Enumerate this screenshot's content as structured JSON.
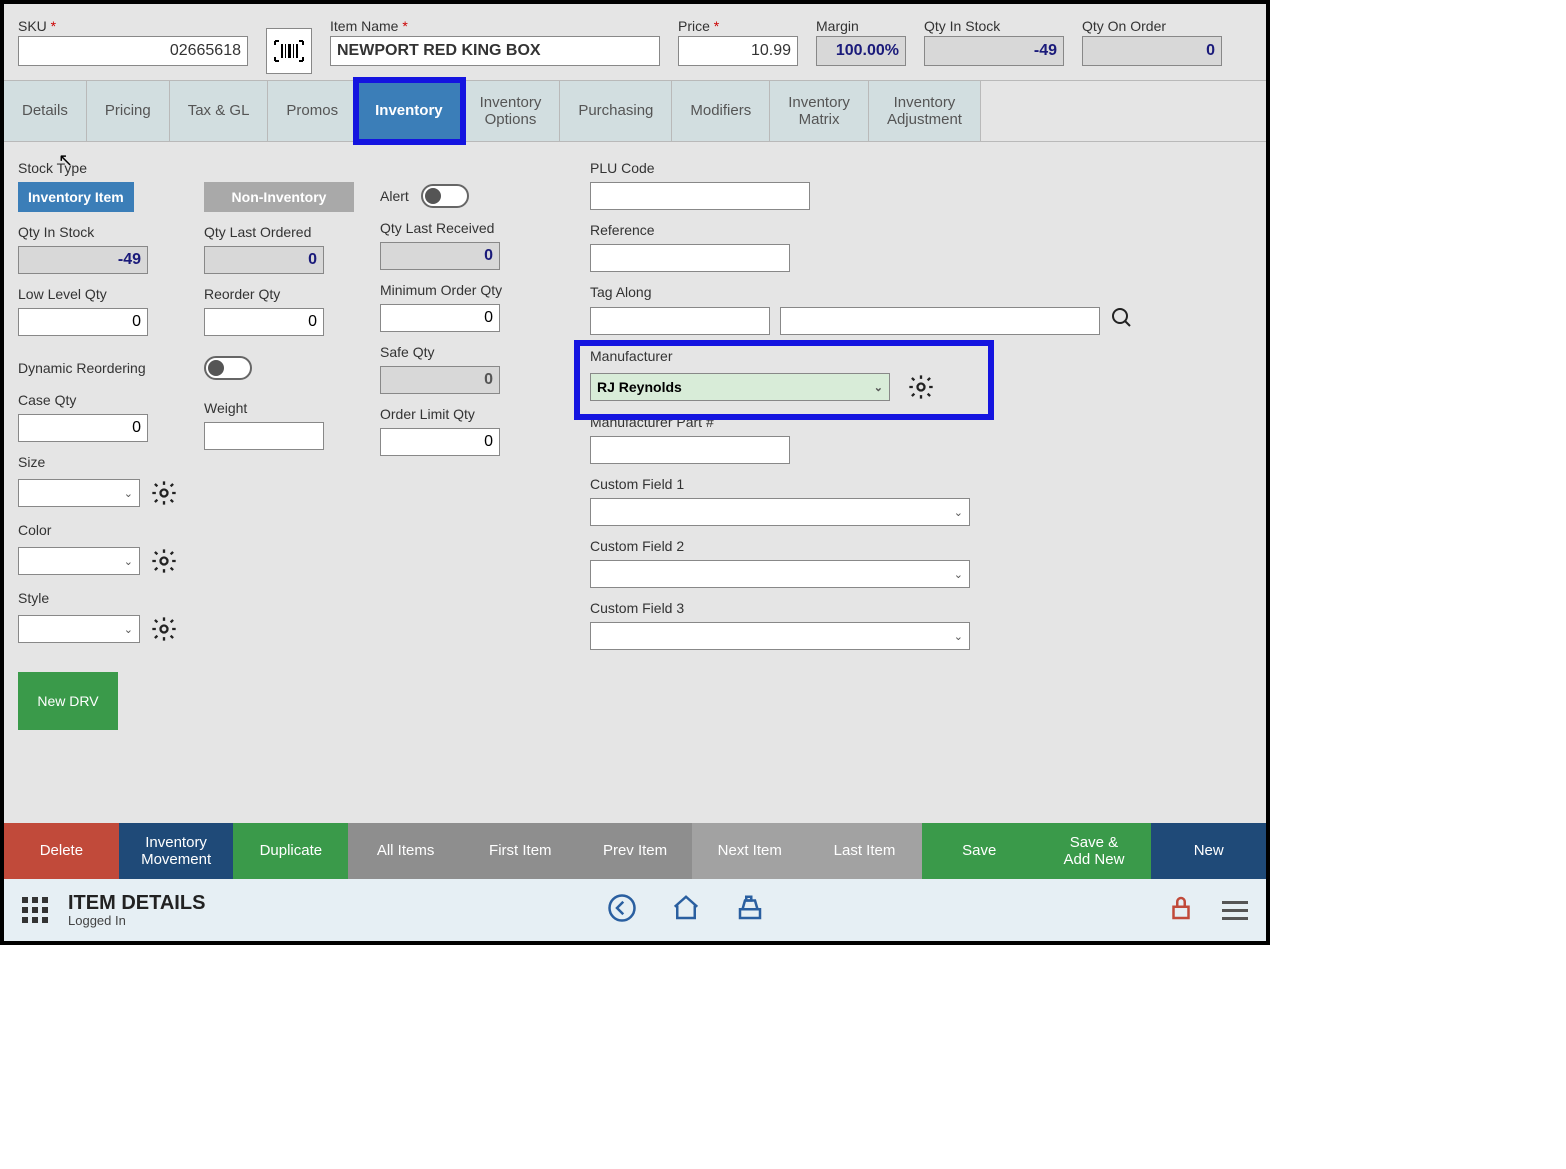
{
  "header": {
    "sku_label": "SKU",
    "sku_value": "02665618",
    "item_name_label": "Item Name",
    "item_name_value": "NEWPORT RED KING BOX",
    "price_label": "Price",
    "price_value": "10.99",
    "margin_label": "Margin",
    "margin_value": "100.00%",
    "qty_in_stock_label": "Qty In Stock",
    "qty_in_stock_value": "-49",
    "qty_on_order_label": "Qty On Order",
    "qty_on_order_value": "0"
  },
  "tabs": [
    "Details",
    "Pricing",
    "Tax & GL",
    "Promos",
    "Inventory",
    "Inventory\nOptions",
    "Purchasing",
    "Modifiers",
    "Inventory\nMatrix",
    "Inventory\nAdjustment"
  ],
  "active_tab": "Inventory",
  "form": {
    "stock_type_label": "Stock Type",
    "stock_inv_item": "Inventory Item",
    "stock_non_inv": "Non-Inventory",
    "alert_label": "Alert",
    "qty_in_stock_label": "Qty In Stock",
    "qty_in_stock_value": "-49",
    "qty_last_ordered_label": "Qty Last Ordered",
    "qty_last_ordered_value": "0",
    "qty_last_received_label": "Qty Last Received",
    "qty_last_received_value": "0",
    "low_level_qty_label": "Low Level Qty",
    "low_level_qty_value": "0",
    "reorder_qty_label": "Reorder Qty",
    "reorder_qty_value": "0",
    "min_order_qty_label": "Minimum Order Qty",
    "min_order_qty_value": "0",
    "dynamic_reordering_label": "Dynamic Reordering",
    "safe_qty_label": "Safe Qty",
    "safe_qty_value": "0",
    "case_qty_label": "Case Qty",
    "case_qty_value": "0",
    "weight_label": "Weight",
    "weight_value": "",
    "order_limit_qty_label": "Order Limit Qty",
    "order_limit_qty_value": "0",
    "size_label": "Size",
    "color_label": "Color",
    "style_label": "Style",
    "plu_code_label": "PLU Code",
    "reference_label": "Reference",
    "tag_along_label": "Tag Along",
    "manufacturer_label": "Manufacturer",
    "manufacturer_value": "RJ Reynolds",
    "mfr_part_label": "Manufacturer Part #",
    "custom1_label": "Custom Field 1",
    "custom2_label": "Custom Field 2",
    "custom3_label": "Custom Field 3",
    "new_drv_label": "New DRV"
  },
  "bottom_bar": [
    "Delete",
    "Inventory\nMovement",
    "Duplicate",
    "All Items",
    "First Item",
    "Prev Item",
    "Next Item",
    "Last Item",
    "Save",
    "Save &\nAdd New",
    "New"
  ],
  "footer": {
    "title": "ITEM DETAILS",
    "status": "Logged In"
  }
}
